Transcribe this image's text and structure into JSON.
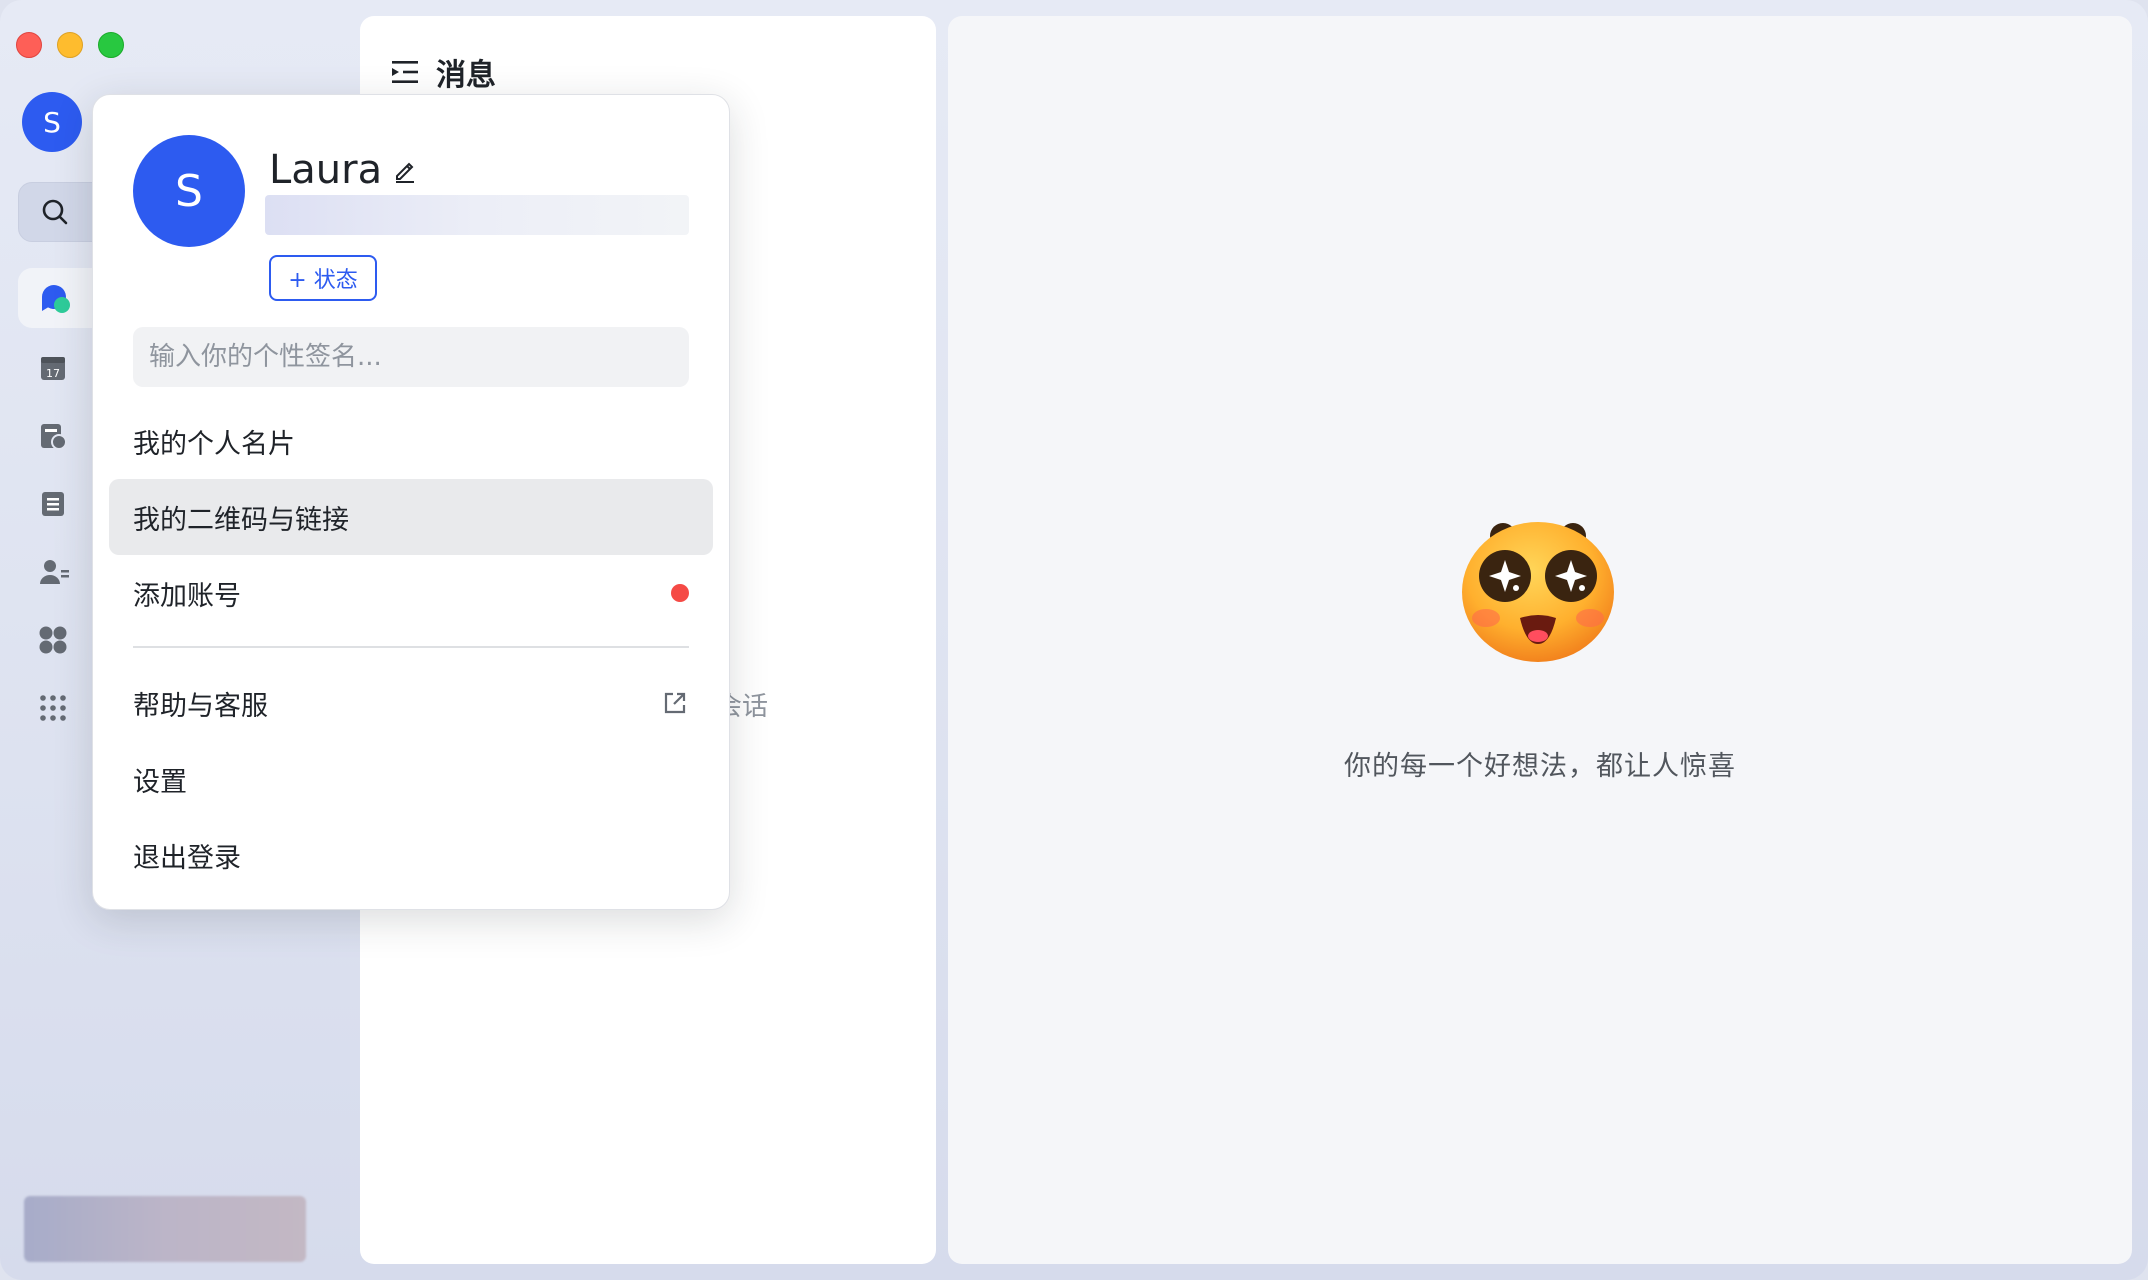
{
  "window": {
    "traffic_lights": [
      "close",
      "minimize",
      "zoom"
    ],
    "colors": {
      "accent": "#2d5bf0",
      "notification": "#f54a45"
    }
  },
  "sidebar": {
    "avatar_letter": "S",
    "icons": [
      "search-icon",
      "messages-icon",
      "calendar-icon",
      "docs-icon",
      "tasks-icon",
      "contacts-icon",
      "workplace-icon",
      "more-apps-icon"
    ],
    "calendar_day": "17"
  },
  "list": {
    "title": "消息",
    "empty_text": "会话"
  },
  "main": {
    "caption": "你的每一个好想法，都让人惊喜"
  },
  "popup": {
    "avatar_letter": "S",
    "name": "Laura",
    "status_label": "+ 状态",
    "signature_placeholder": "输入你的个性签名...",
    "items": [
      {
        "label": "我的个人名片"
      },
      {
        "label": "我的二维码与链接"
      },
      {
        "label": "添加账号"
      },
      {
        "label": "帮助与客服"
      },
      {
        "label": "设置"
      },
      {
        "label": "退出登录"
      }
    ]
  }
}
